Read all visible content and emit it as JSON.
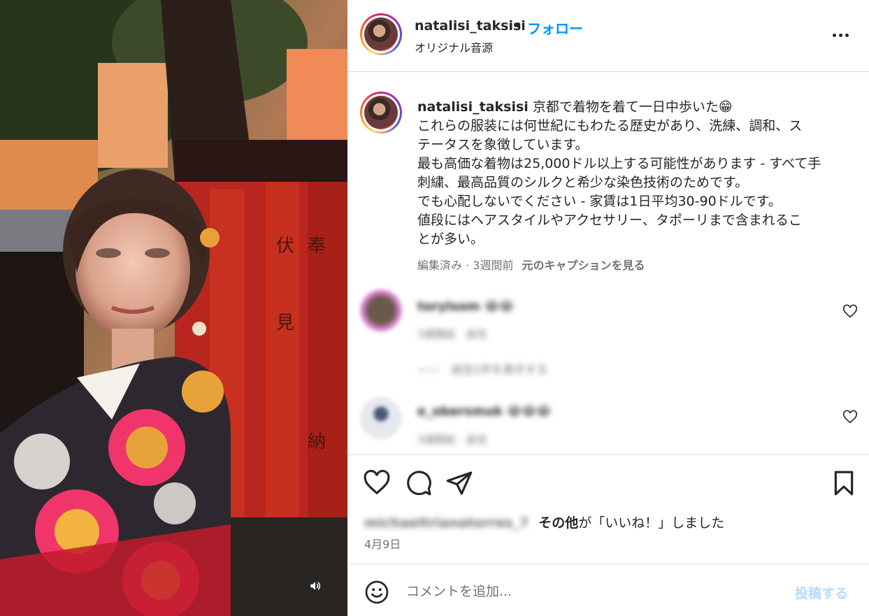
{
  "header": {
    "username": "natalisi_taksisi",
    "separator": "•",
    "follow_label": "フォロー",
    "audio_label": "オリジナル音源"
  },
  "caption": {
    "username": "natalisi_taksisi",
    "lines": [
      "京都で着物を着て一日中歩いた😁",
      "これらの服装には何世紀にもわたる歴史があり、洗練、調和、ス",
      "テータスを象徴しています。",
      "最も高価な着物は25,000ドル以上する可能性があります - すべて手",
      "刺繍、最高品質のシルクと希少な染色技術のためです。",
      "でも心配しないでください - 家賃は1日平均30-90ドルです。",
      "値段にはヘアスタイルやアクセサリー、タポーリまで含まれるこ",
      "とが多い。"
    ],
    "meta": "編集済み · 3週間前",
    "see_original_label": "元のキャプションを見る"
  },
  "comments": [
    {
      "username": "torylsom 😂😂",
      "meta": "3週間前　返信"
    },
    {
      "username": "e_obersmuk 😂😂😂",
      "meta": "3週間前　返信"
    }
  ],
  "replies_toggle": "——　返信1件を表示する",
  "likes": {
    "liked_by_user": "michaeltrianatorres_7",
    "others_label": "その他",
    "suffix": "が「いいね！」しました"
  },
  "post_date": "4月9日",
  "comment_box": {
    "placeholder": "コメントを追加...",
    "post_label": "投稿する"
  },
  "icons": {
    "more": "more-horizontal-icon",
    "like": "heart-icon",
    "comment": "comment-bubble-icon",
    "share": "paper-plane-icon",
    "save": "bookmark-icon",
    "emoji": "smiley-icon",
    "audio": "speaker-icon"
  },
  "colors": {
    "accent": "#0095f6",
    "post_disabled": "#b3dbff",
    "secondary_text": "#737373",
    "divider": "#dbdbdb"
  }
}
